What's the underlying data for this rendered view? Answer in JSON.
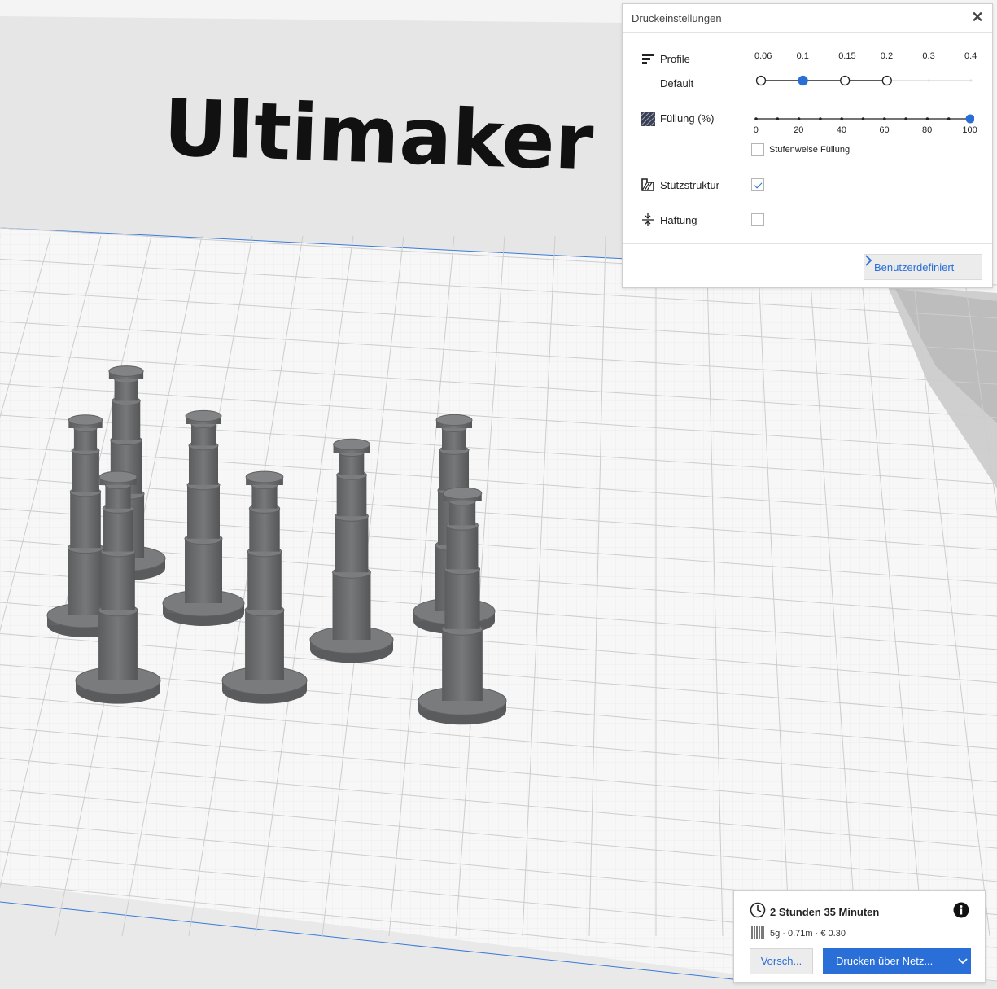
{
  "scene": {
    "backdrop_text": "Ultimaker"
  },
  "print_settings": {
    "title": "Druckeinstellungen",
    "close_symbol": "✕",
    "profile": {
      "label": "Profile",
      "value": "Default",
      "ticks": [
        "0.06",
        "0.1",
        "0.15",
        "0.2",
        "0.3",
        "0.4"
      ],
      "selected": "0.1",
      "available_count": 4
    },
    "infill": {
      "label": "Füllung (%)",
      "ticks": [
        "0",
        "20",
        "40",
        "60",
        "80",
        "100"
      ],
      "value": 100,
      "gradual_label": "Stufenweise Füllung",
      "gradual_checked": false
    },
    "support": {
      "label": "Stützstruktur",
      "checked": true
    },
    "adhesion": {
      "label": "Haftung",
      "checked": false
    },
    "custom_button": "Benutzerdefiniert"
  },
  "action_panel": {
    "time": "2 Stunden 35 Minuten",
    "material": "5g · 0.71m · € 0.30",
    "preview_button": "Vorsch...",
    "print_button": "Drucken über Netz..."
  },
  "colors": {
    "accent": "#2a6fd8",
    "model": "#6d6e70",
    "plate": "#f7f7f7"
  },
  "icons": {
    "profile": "profile-icon",
    "infill": "infill-icon",
    "support": "support-icon",
    "adhesion": "adhesion-icon",
    "clock": "clock-icon",
    "info": "info-icon",
    "spool": "spool-icon"
  }
}
